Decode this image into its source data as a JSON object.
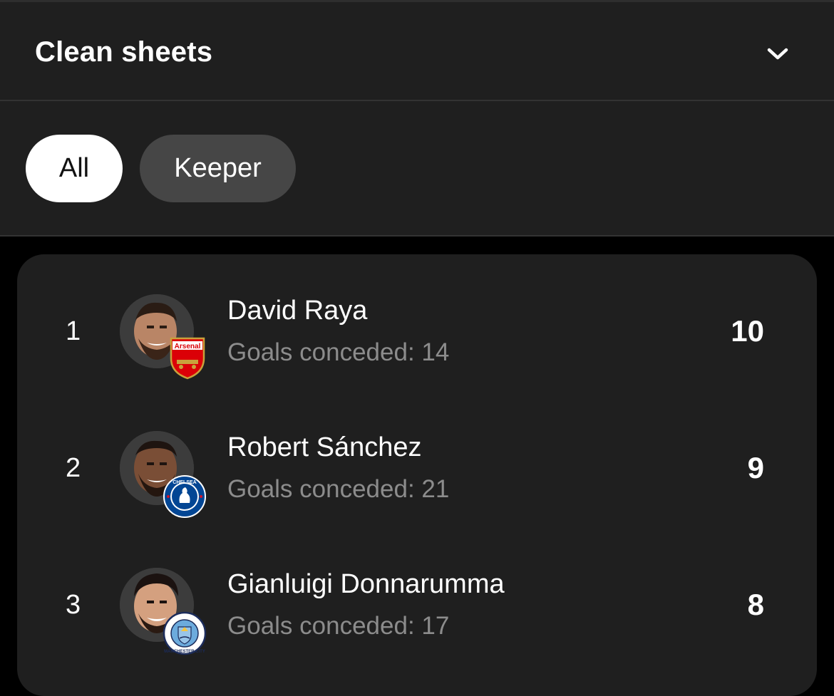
{
  "header": {
    "title": "Clean sheets",
    "toggle_icon": "chevron-down-icon"
  },
  "filters": [
    {
      "label": "All",
      "selected": true
    },
    {
      "label": "Keeper",
      "selected": false
    }
  ],
  "players": [
    {
      "rank": "1",
      "name": "David Raya",
      "subtitle": "Goals conceded: 14",
      "value": "10",
      "club_badge": "arsenal-badge",
      "badge_text": "Arsenal"
    },
    {
      "rank": "2",
      "name": "Robert Sánchez",
      "subtitle": "Goals conceded: 21",
      "value": "9",
      "club_badge": "chelsea-badge",
      "badge_text": "CHELSEA"
    },
    {
      "rank": "3",
      "name": "Gianluigi Donnarumma",
      "subtitle": "Goals conceded: 17",
      "value": "8",
      "club_badge": "manchester-city-badge",
      "badge_text": "MANCHESTER CITY"
    }
  ],
  "colors": {
    "background": "#000000",
    "panel": "#1f1f1f",
    "chip_selected": "#ffffff",
    "chip_unselected": "#464646",
    "secondary_text": "#8c8c8c"
  }
}
